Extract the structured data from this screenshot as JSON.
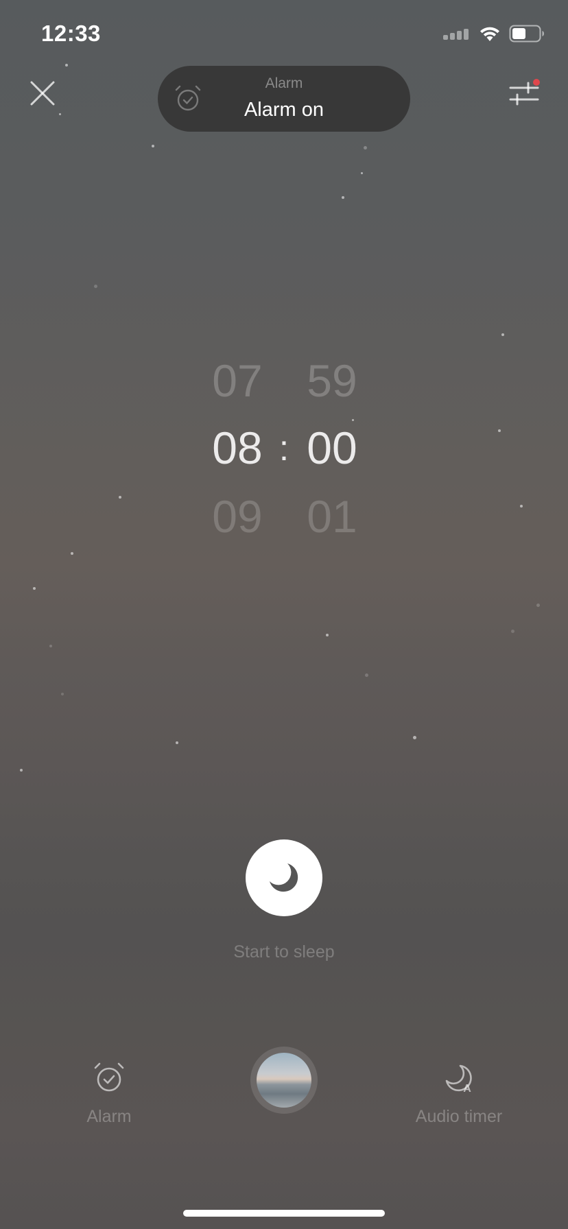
{
  "status_bar": {
    "time": "12:33",
    "icons": [
      "cellular-signal-icon",
      "wifi-icon",
      "battery-icon"
    ]
  },
  "header": {
    "close_icon": "close-icon",
    "pill": {
      "icon": "alarm-check-icon",
      "caption": "Alarm",
      "status": "Alarm on"
    },
    "settings_icon": "sliders-icon",
    "settings_notification_color": "#e0474c"
  },
  "time_picker": {
    "hours": {
      "prev": "07",
      "selected": "08",
      "next": "09"
    },
    "separator": ":",
    "minutes": {
      "prev": "59",
      "selected": "00",
      "next": "01"
    }
  },
  "sleep": {
    "icon": "moon-icon",
    "label": "Start to sleep"
  },
  "bottom_nav": {
    "alarm": {
      "icon": "alarm-check-icon",
      "label": "Alarm"
    },
    "scene": {
      "icon": "scene-thumbnail"
    },
    "audio_timer": {
      "icon": "moon-auto-icon",
      "label": "Audio timer"
    }
  }
}
